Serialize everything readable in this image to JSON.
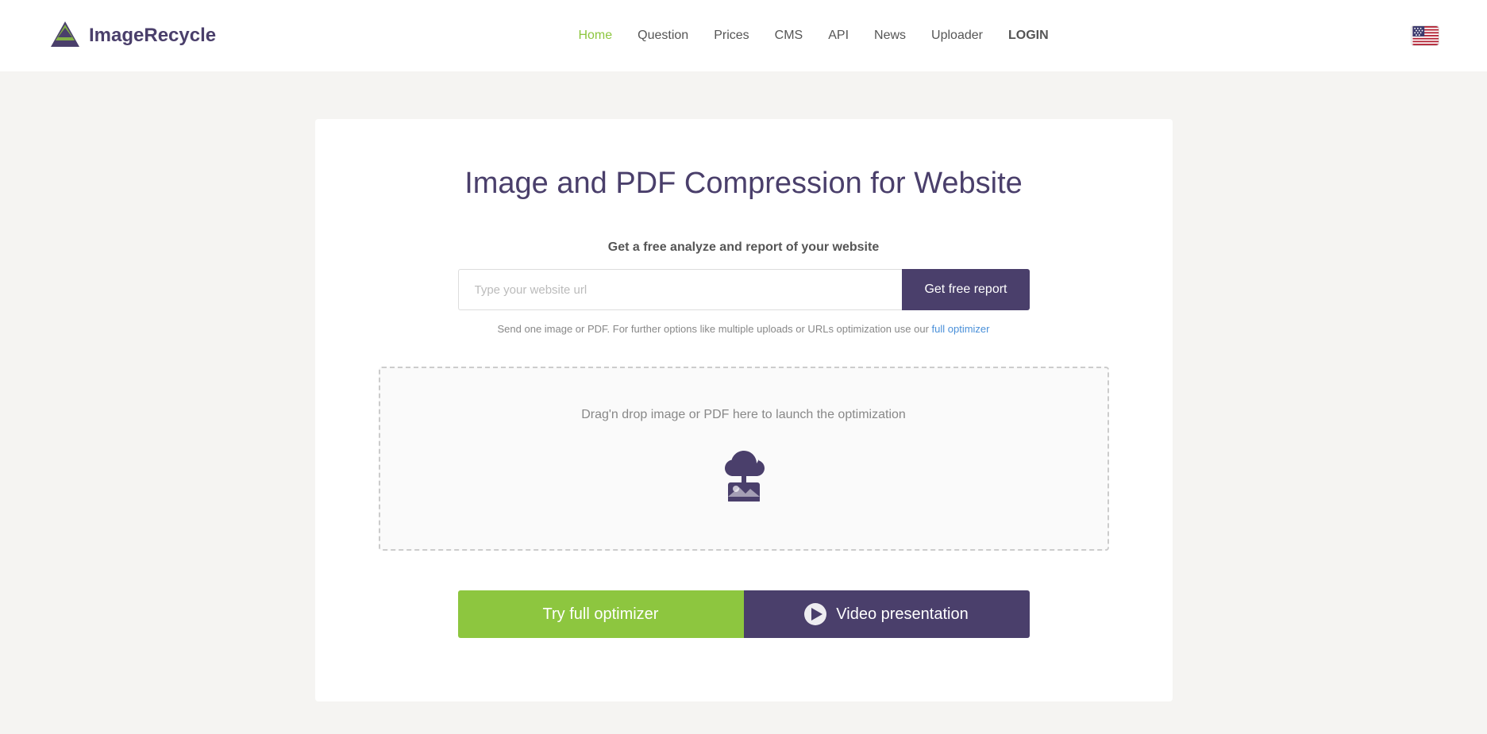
{
  "logo": {
    "text_image": "Image",
    "text_recycle": "Recycle"
  },
  "nav": {
    "items": [
      {
        "label": "Home",
        "active": true
      },
      {
        "label": "Question",
        "active": false
      },
      {
        "label": "Prices",
        "active": false
      },
      {
        "label": "CMS",
        "active": false
      },
      {
        "label": "API",
        "active": false
      },
      {
        "label": "News",
        "active": false
      },
      {
        "label": "Uploader",
        "active": false
      },
      {
        "label": "LOGIN",
        "active": false
      }
    ]
  },
  "main": {
    "title": "Image and PDF Compression for Website",
    "subtitle": "Get a free analyze and report of your website",
    "url_input_placeholder": "Type your website url",
    "get_report_button": "Get free report",
    "helper_text_before": "Send one image or PDF. For further options like multiple uploads or URLs optimization use our ",
    "helper_link": "full optimizer",
    "helper_text_after": "",
    "drop_zone_text": "Drag'n drop image or PDF here to launch the optimization",
    "try_optimizer_button": "Try full optimizer",
    "video_button": "Video presentation"
  },
  "colors": {
    "purple": "#4a3f6b",
    "green": "#8dc63f",
    "link_blue": "#4a90d9"
  }
}
